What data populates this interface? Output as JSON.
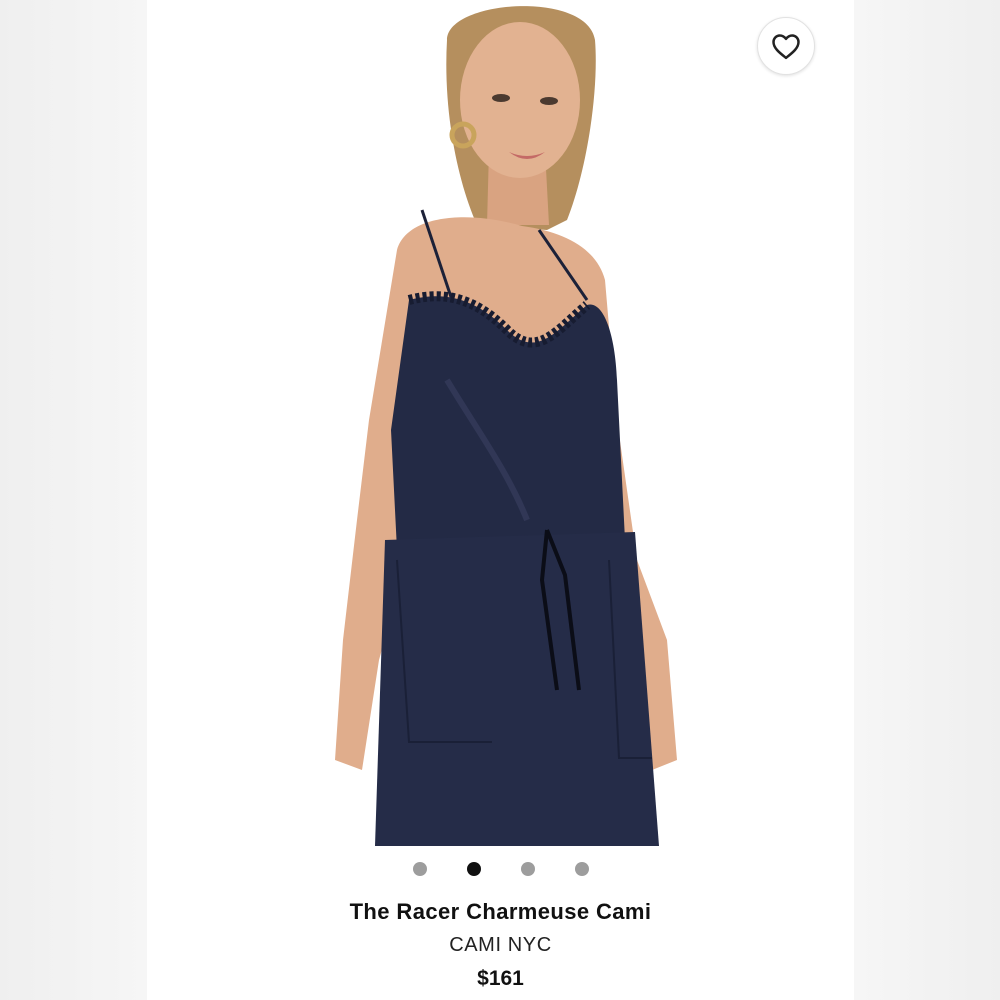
{
  "product": {
    "title": "The Racer Charmeuse Cami",
    "brand": "CAMI NYC",
    "price": "$161",
    "image_alt": "Model wearing navy satin charmeuse cami with lace trim"
  },
  "gallery": {
    "total_images": 4,
    "active_index": 2
  },
  "favorite": {
    "icon": "heart-outline-icon"
  },
  "colors": {
    "garment": "#232a45",
    "skin": "#e0ad8c",
    "hair": "#b58f5e",
    "dot_active": "#111111",
    "dot_inactive": "#9d9d9d"
  }
}
